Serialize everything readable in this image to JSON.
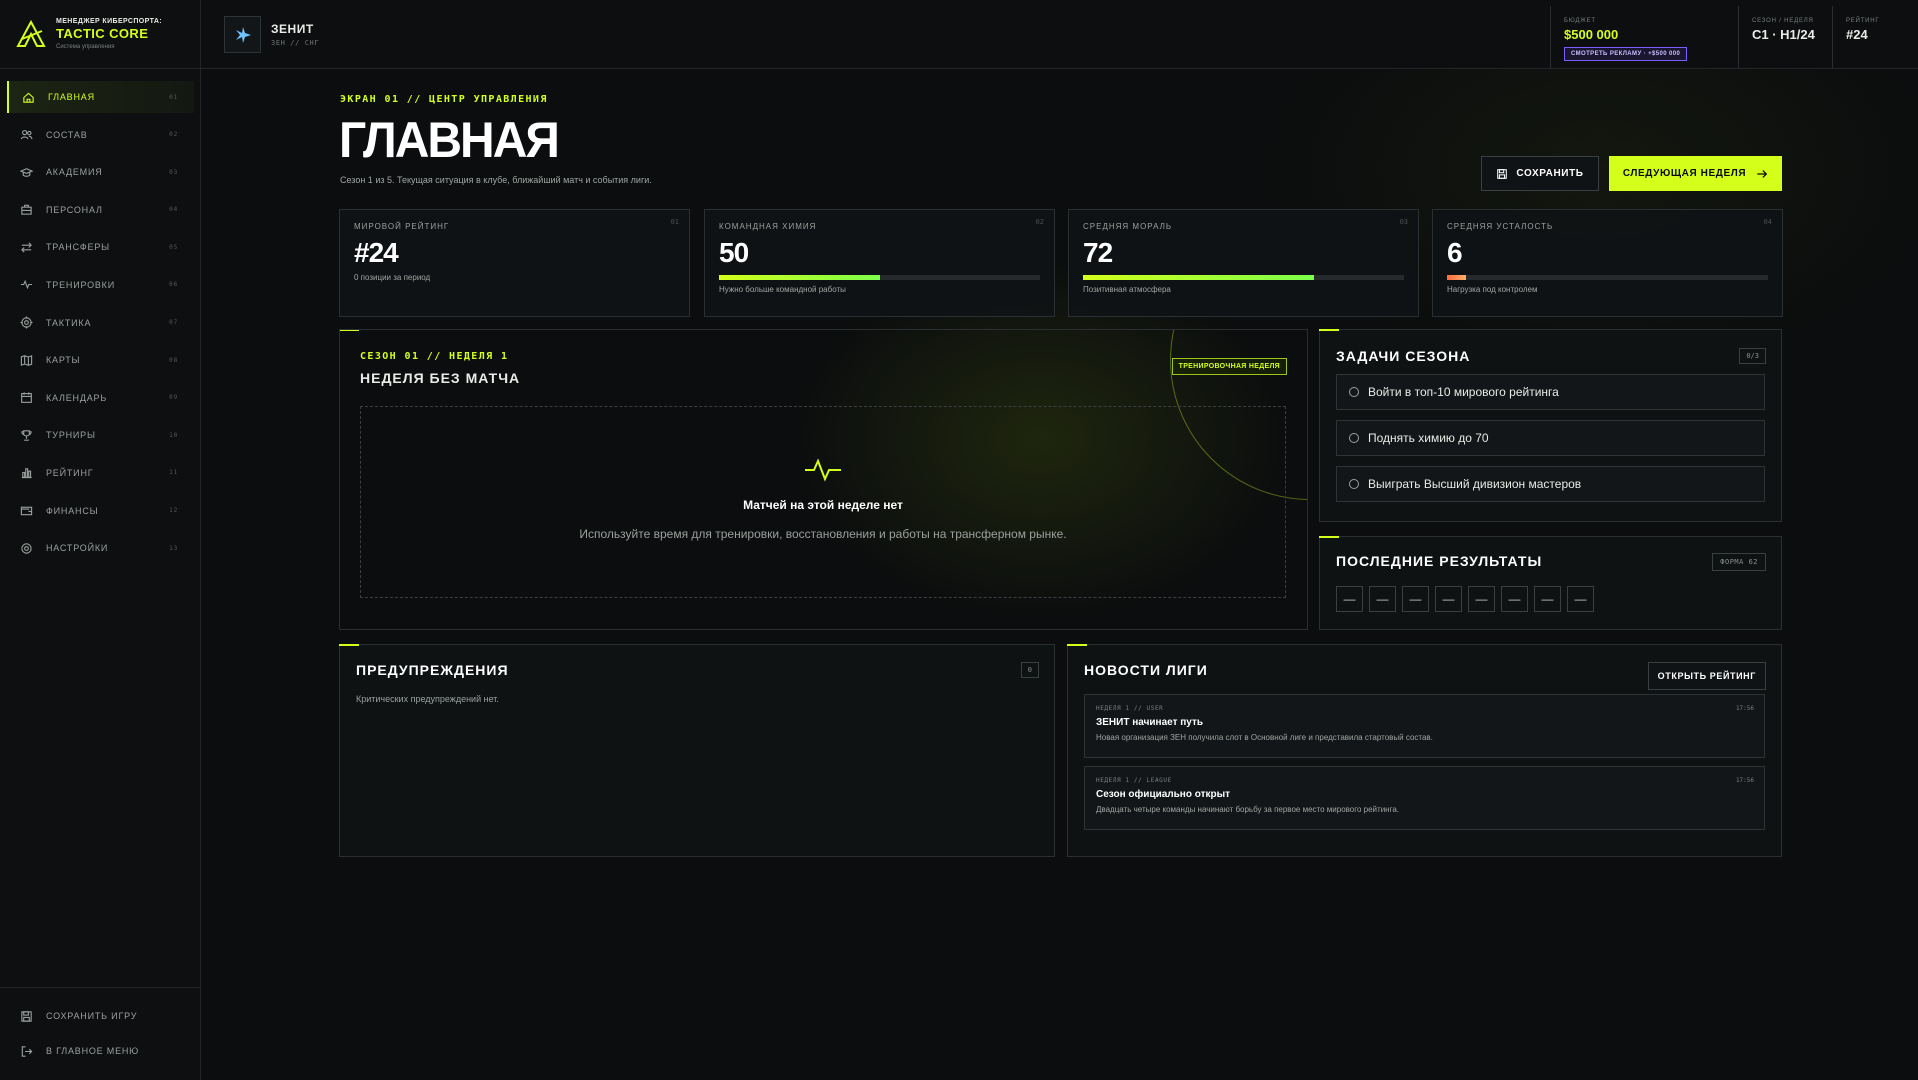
{
  "brand": {
    "line1": "МЕНЕДЖЕР КИБЕРСПОРТА:",
    "line2": "TACTIC CORE",
    "line3": "Система управления"
  },
  "nav": {
    "items": [
      {
        "label": "ГЛАВНАЯ",
        "num": "01",
        "icon": "home-icon"
      },
      {
        "label": "СОСТАВ",
        "num": "02",
        "icon": "users-icon"
      },
      {
        "label": "АКАДЕМИЯ",
        "num": "03",
        "icon": "graduation-icon"
      },
      {
        "label": "ПЕРСОНАЛ",
        "num": "04",
        "icon": "briefcase-icon"
      },
      {
        "label": "ТРАНСФЕРЫ",
        "num": "05",
        "icon": "transfer-icon"
      },
      {
        "label": "ТРЕНИРОВКИ",
        "num": "06",
        "icon": "activity-icon"
      },
      {
        "label": "ТАКТИКА",
        "num": "07",
        "icon": "target-icon"
      },
      {
        "label": "КАРТЫ",
        "num": "08",
        "icon": "map-icon"
      },
      {
        "label": "КАЛЕНДАРЬ",
        "num": "09",
        "icon": "calendar-icon"
      },
      {
        "label": "ТУРНИРЫ",
        "num": "10",
        "icon": "trophy-icon"
      },
      {
        "label": "РЕЙТИНГ",
        "num": "11",
        "icon": "bar-chart-icon"
      },
      {
        "label": "ФИНАНСЫ",
        "num": "12",
        "icon": "wallet-icon"
      },
      {
        "label": "НАСТРОЙКИ",
        "num": "13",
        "icon": "settings-icon"
      }
    ],
    "bottom": [
      {
        "label": "СОХРАНИТЬ ИГРУ",
        "icon": "save-icon"
      },
      {
        "label": "В ГЛАВНОЕ МЕНЮ",
        "icon": "logout-icon"
      }
    ]
  },
  "club": {
    "name": "ЗЕНИТ",
    "sub": "ЗЕН // СНГ"
  },
  "top_stats": {
    "budget_label": "БЮДЖЕТ",
    "budget_value": "$500 000",
    "ad_button": "СМОТРЕТЬ РЕКЛАМУ · +$500 000",
    "season_label": "СЕЗОН / НЕДЕЛЯ",
    "season_value": "С1 · Н1/24",
    "rating_label": "РЕЙТИНГ",
    "rating_value": "#24"
  },
  "header": {
    "kicker": "ЭКРАН 01 // ЦЕНТР УПРАВЛЕНИЯ",
    "title": "ГЛАВНАЯ",
    "subtitle": "Сезон 1 из 5. Текущая ситуация в клубе, ближайший матч и события лиги.",
    "save_label": "СОХРАНИТЬ",
    "next_label": "СЛЕДУЮЩАЯ НЕДЕЛЯ"
  },
  "kpis": [
    {
      "label": "МИРОВОЙ РЕЙТИНГ",
      "num": "01",
      "value": "#24",
      "note": "0 позиции за период"
    },
    {
      "label": "КОМАНДНАЯ ХИМИЯ",
      "num": "02",
      "value": "50",
      "progress": 50,
      "note": "Нужно больше командной работы"
    },
    {
      "label": "СРЕДНЯЯ МОРАЛЬ",
      "num": "03",
      "value": "72",
      "progress": 72,
      "note": "Позитивная атмосфера"
    },
    {
      "label": "СРЕДНЯЯ УСТАЛОСТЬ",
      "num": "04",
      "value": "6",
      "progress": 6,
      "note": "Нагрузка под контролем"
    }
  ],
  "week": {
    "kicker": "СЕЗОН 01 // НЕДЕЛЯ 1",
    "title": "НЕДЕЛЯ БЕЗ МАТЧА",
    "badge": "ТРЕНИРОВОЧНАЯ НЕДЕЛЯ",
    "empty_title": "Матчей на этой неделе нет",
    "empty_sub": "Используйте время для тренировки, восстановления и работы на трансферном рынке."
  },
  "goals": {
    "title": "ЗАДАЧИ СЕЗОНА",
    "count": "0/3",
    "items": [
      "Войти в топ-10 мирового рейтинга",
      "Поднять химию до 70",
      "Выиграть Высший дивизион мастеров"
    ]
  },
  "results": {
    "title": "ПОСЛЕДНИЕ РЕЗУЛЬТАТЫ",
    "badge": "ФОРМА 62",
    "items": [
      "—",
      "—",
      "—",
      "—",
      "—",
      "—",
      "—",
      "—"
    ]
  },
  "warnings": {
    "title": "ПРЕДУПРЕЖДЕНИЯ",
    "count": "0",
    "empty": "Критических предупреждений нет."
  },
  "news": {
    "title": "НОВОСТИ ЛИГИ",
    "open_label": "ОТКРЫТЬ РЕЙТИНГ",
    "items": [
      {
        "meta": "НЕДЕЛЯ 1 // USER",
        "time": "17:56",
        "title": "ЗЕНИТ начинает путь",
        "body": "Новая организация ЗЕН получила слот в Основной лиге и представила стартовый состав."
      },
      {
        "meta": "НЕДЕЛЯ 1 // LEAGUE",
        "time": "17:56",
        "title": "Сезон официально открыт",
        "body": "Двадцать четыре команды начинают борьбу за первое место мирового рейтинга."
      }
    ]
  },
  "colors": {
    "accent": "#d4ff1a",
    "background": "#0b0d0e",
    "ad_accent": "#7a5cff",
    "warn": "#ff6a3d"
  }
}
